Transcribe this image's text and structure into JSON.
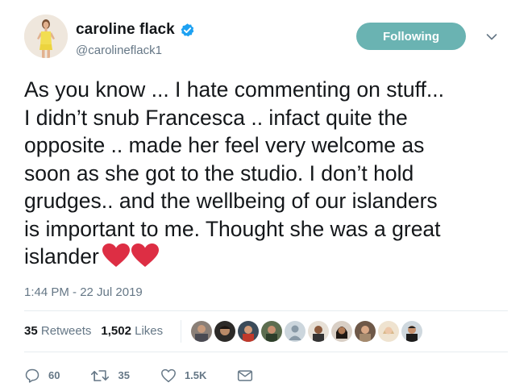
{
  "user": {
    "display_name": "caroline flack",
    "handle": "@carolineflack1",
    "verified": true,
    "avatar_icon": "avatar-photo"
  },
  "follow_button": {
    "label": "Following",
    "color": "#6ab3b2"
  },
  "tweet": {
    "text": "As you know ... I hate commenting on stuff...\nI didn’t snub Francesca .. infact quite the\nopposite .. made her feel very welcome as\nsoon as she got to the studio. I don’t hold\ngrudges.. and the wellbeing of our islanders\nis important to me. Thought she was a great\nislander",
    "emoji": [
      "red-heart-icon",
      "red-heart-icon"
    ],
    "timestamp": "1:44 PM - 22 Jul 2019"
  },
  "stats": {
    "retweets_count": "35",
    "retweets_label": "Retweets",
    "likes_count": "1,502",
    "likes_label": "Likes",
    "likers": [
      "avatar",
      "avatar",
      "avatar",
      "avatar",
      "avatar",
      "avatar",
      "avatar",
      "avatar",
      "avatar",
      "avatar"
    ]
  },
  "actions": {
    "replies": "60",
    "retweets": "35",
    "likes": "1.5K"
  },
  "colors": {
    "accent": "#1da1f2",
    "heart": "#e0245e",
    "secondary_text": "#657786"
  }
}
